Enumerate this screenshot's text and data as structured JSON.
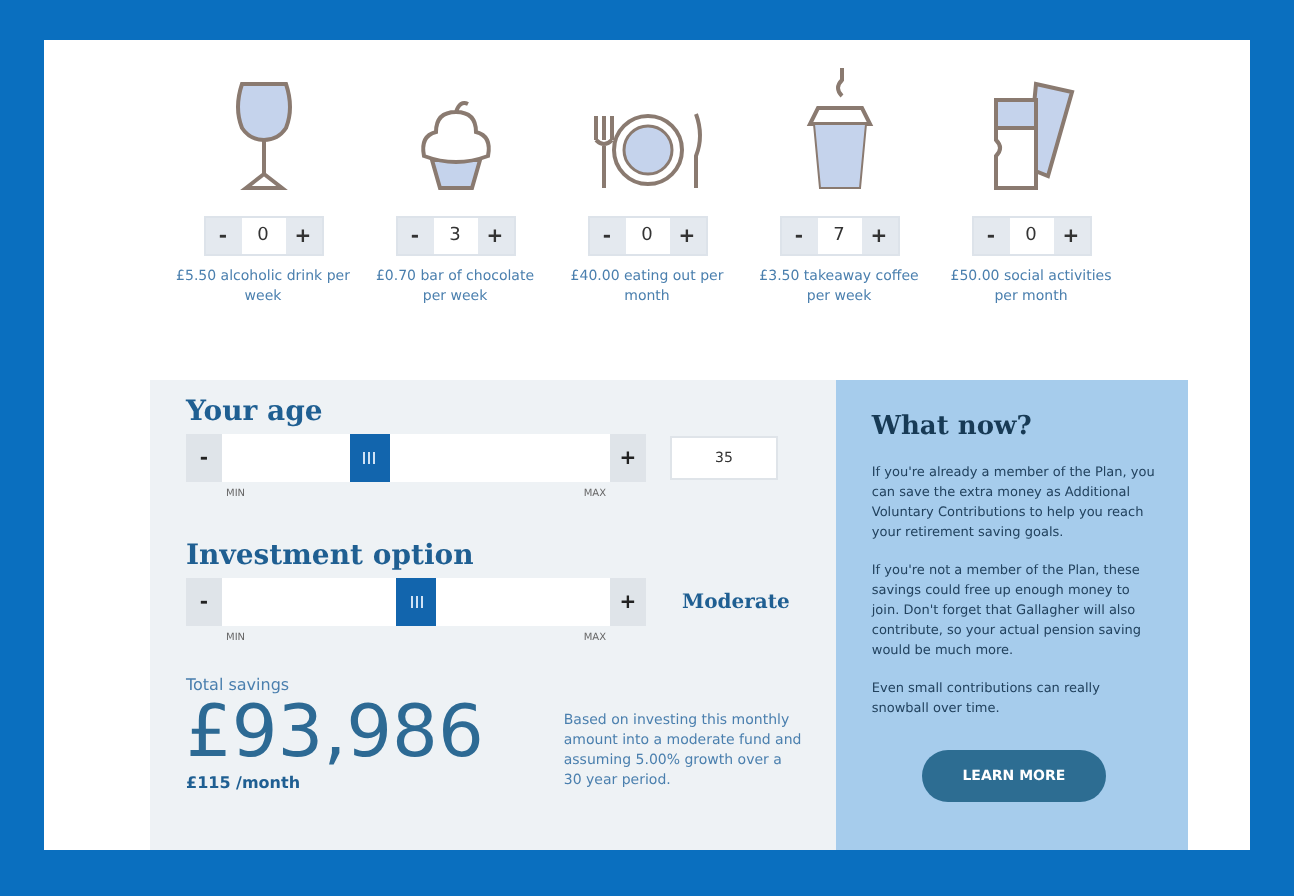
{
  "items": [
    {
      "kind": "wine",
      "minus": "-",
      "value": "0",
      "plus": "+",
      "caption": "£5.50 alcoholic drink per week"
    },
    {
      "kind": "cupcake",
      "minus": "-",
      "value": "3",
      "plus": "+",
      "caption": "£0.70 bar of chocolate per week"
    },
    {
      "kind": "plate",
      "minus": "-",
      "value": "0",
      "plus": "+",
      "caption": "£40.00 eating out per month"
    },
    {
      "kind": "coffee",
      "minus": "-",
      "value": "7",
      "plus": "+",
      "caption": "£3.50 takeaway coffee per week"
    },
    {
      "kind": "tickets",
      "minus": "-",
      "value": "0",
      "plus": "+",
      "caption": "£50.00 social activities per month"
    }
  ],
  "sliders": [
    {
      "kind": "field",
      "title": "Your age",
      "minus": "-",
      "plus": "+",
      "level": 0.38,
      "min_label": "MIN",
      "max_label": "MAX",
      "value": "35"
    },
    {
      "kind": "reading",
      "title": "Investment option",
      "minus": "-",
      "plus": "+",
      "level": 0.5,
      "min_label": "MIN",
      "max_label": "MAX",
      "value": "Moderate"
    }
  ],
  "total": {
    "label": "Total savings",
    "amount": "£93,986",
    "monthly": "£115 /month",
    "note": "Based on investing this monthly amount into a moderate fund and assuming 5.00% growth over a 30 year period."
  },
  "what_now": {
    "title": "What now?",
    "paragraphs": [
      "If you're already a member of the Plan, you can save the extra money as Additional Voluntary Contributions to help you reach your retirement saving goals.",
      "If you're not a member of the Plan, these savings could free up enough money to join. Don't forget that Gallagher will also contribute, so your actual pension saving would be much more.",
      "Even small contributions can really snowball over time."
    ],
    "button": "LEARN MORE"
  }
}
